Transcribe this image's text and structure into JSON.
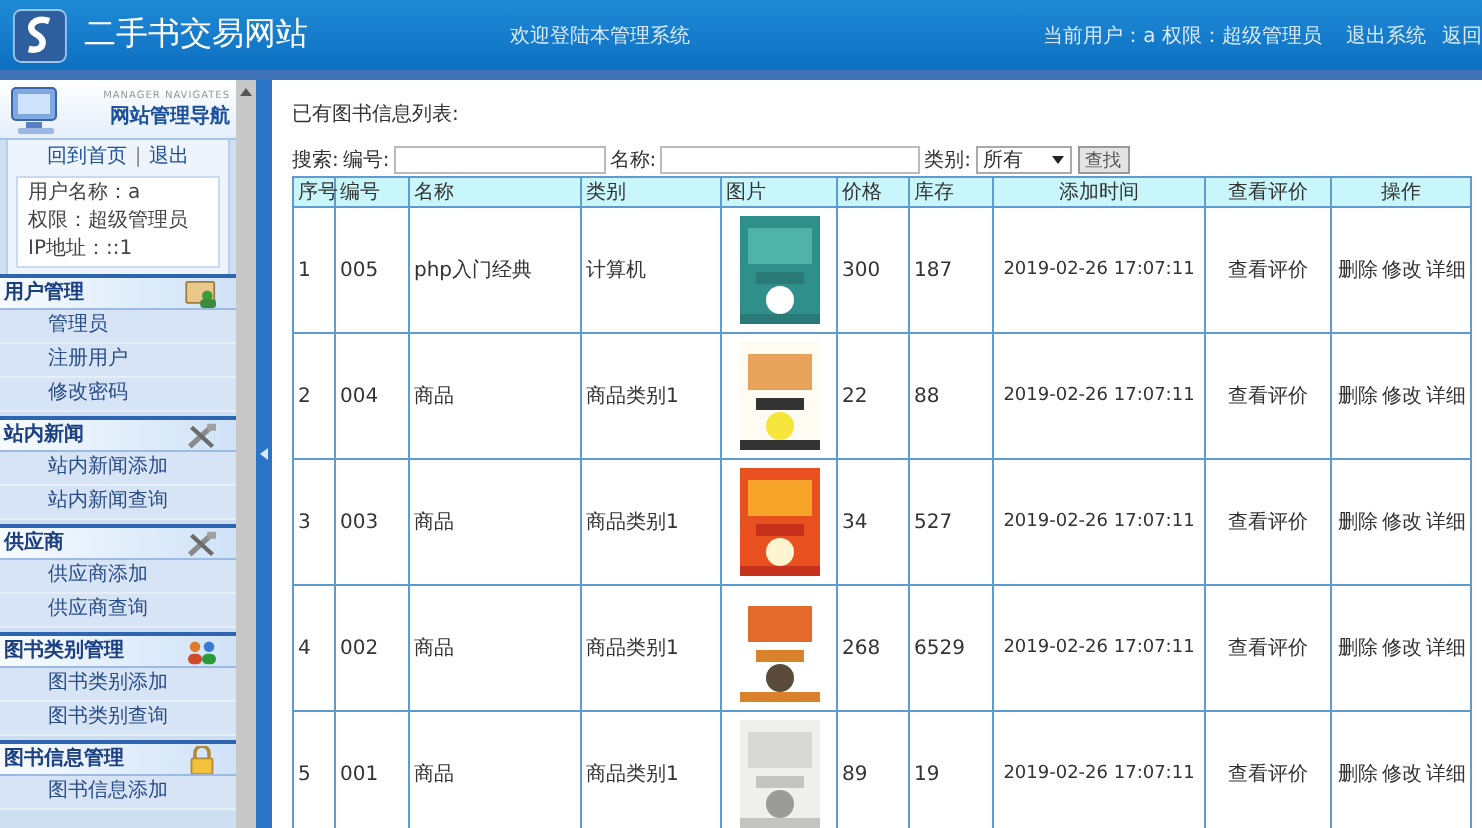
{
  "header": {
    "title": "二手书交易网站",
    "welcome": "欢迎登陆本管理系统",
    "current_user": "当前用户：a 权限：超级管理员",
    "links": [
      "退出系统",
      "返回"
    ]
  },
  "sidebar": {
    "tagline": "MANAGER NAVIGATES",
    "title": "网站管理导航",
    "links": [
      "回到首页",
      "退出"
    ],
    "separator": "|",
    "info": [
      "用户名称：a",
      "权限：超级管理员",
      "IP地址：::1"
    ],
    "sections": [
      {
        "title": "用户管理",
        "kind": "user",
        "items": [
          "管理员",
          "注册用户",
          "修改密码"
        ]
      },
      {
        "title": "站内新闻",
        "kind": "tools",
        "items": [
          "站内新闻添加",
          "站内新闻查询"
        ]
      },
      {
        "title": "供应商",
        "kind": "tools",
        "items": [
          "供应商添加",
          "供应商查询"
        ]
      },
      {
        "title": "图书类别管理",
        "kind": "people",
        "items": [
          "图书类别添加",
          "图书类别查询"
        ]
      },
      {
        "title": "图书信息管理",
        "kind": "lock",
        "items": [
          "图书信息添加"
        ]
      }
    ]
  },
  "main": {
    "heading": "已有图书信息列表:",
    "search": {
      "label": "搜索:",
      "fields": [
        {
          "label": "编号:"
        },
        {
          "label": "名称:"
        }
      ],
      "category_label": "类别:",
      "category_value": "所有",
      "button": "查找"
    },
    "table": {
      "columns": [
        "序号",
        "编号",
        "名称",
        "类别",
        "图片",
        "价格",
        "库存",
        "添加时间",
        "查看评价",
        "操作"
      ],
      "rows": [
        {
          "cells": [
            "1",
            "005",
            "php入门经典",
            "计算机"
          ],
          "price": "300",
          "stock": "187",
          "added": "2019-02-26 17:07:11",
          "review": "查看评价",
          "actions": [
            "删除",
            "修改",
            "详细"
          ]
        },
        {
          "cells": [
            "2",
            "004",
            "商品",
            "商品类别1"
          ],
          "price": "22",
          "stock": "88",
          "added": "2019-02-26 17:07:11",
          "review": "查看评价",
          "actions": [
            "删除",
            "修改",
            "详细"
          ]
        },
        {
          "cells": [
            "3",
            "003",
            "商品",
            "商品类别1"
          ],
          "price": "34",
          "stock": "527",
          "added": "2019-02-26 17:07:11",
          "review": "查看评价",
          "actions": [
            "删除",
            "修改",
            "详细"
          ]
        },
        {
          "cells": [
            "4",
            "002",
            "商品",
            "商品类别1"
          ],
          "price": "268",
          "stock": "6529",
          "added": "2019-02-26 17:07:11",
          "review": "查看评价",
          "actions": [
            "删除",
            "修改",
            "详细"
          ]
        },
        {
          "cells": [
            "5",
            "001",
            "商品",
            "商品类别1"
          ],
          "price": "89",
          "stock": "19",
          "added": "2019-02-26 17:07:11",
          "review": "查看评价",
          "actions": [
            "删除",
            "修改",
            "详细"
          ]
        }
      ]
    }
  }
}
